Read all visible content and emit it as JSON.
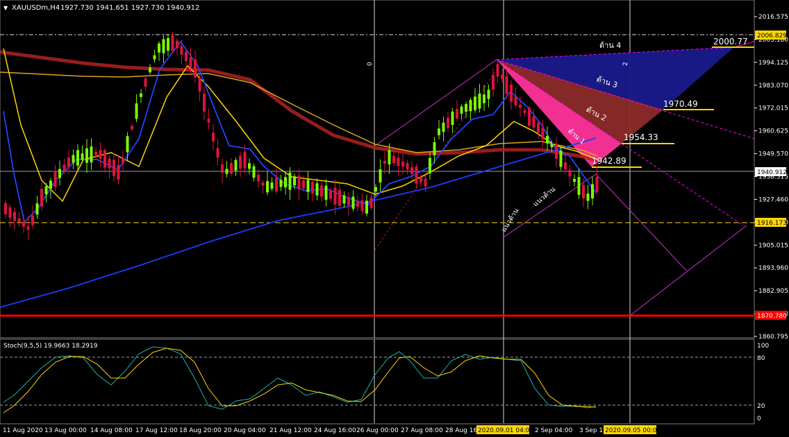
{
  "window": {
    "title": "XAUUSDm,H4",
    "ohlc": "1927.730 1941.651 1927.730 1940.912"
  },
  "price_axis": {
    "ticks": [
      "2016.575",
      "2005.180",
      "1994.125",
      "1983.070",
      "1972.015",
      "1960.625",
      "1949.570",
      "1938.515",
      "1927.460",
      "1916.070",
      "1905.015",
      "1893.960",
      "1882.905",
      "1871.850",
      "1860.795"
    ],
    "tags": {
      "upper_level": "2006.829",
      "current": "1940.912",
      "support": "1916.173",
      "lower_level": "1870.780"
    }
  },
  "time_axis": {
    "labels": [
      "11 Aug 2020",
      "13 Aug 00:00",
      "14 Aug 08:00",
      "17 Aug 12:00",
      "18 Aug 20:00",
      "20 Aug 04:00",
      "21 Aug 12:00",
      "24 Aug 16:00",
      "26 Aug 00:00",
      "27 Aug 08:00",
      "28 Aug 16",
      "2 Sep 04:00",
      "3 Sep 1"
    ],
    "tags": [
      "2020.09.01 04:00",
      "2020.09.05 00:00"
    ]
  },
  "annotations": {
    "levels": [
      "2000.77",
      "1970.49",
      "1954.33",
      "1942.89"
    ],
    "resist": [
      "ต้าน 4",
      "ต้าน 3",
      "ต้าน 2",
      "ต้าน 1"
    ],
    "brace_left": "แนวต้าน",
    "brace_right": "แนวต้าน",
    "vline_a": "0",
    "vline_b": "2"
  },
  "stoch": {
    "label": "Stoch(9,5,5) 19.9663 18.2919",
    "levels": [
      "100",
      "80",
      "20",
      "0"
    ]
  },
  "colors": {
    "background": "#000000",
    "bull": "#7CFC00",
    "bear": "#DC143C",
    "ma_blue": "#1E3CFF",
    "ma_gold": "#FFD700",
    "ma_red": "#B22222",
    "fan_magenta": "#FF00FF",
    "fan_pink": "#FF3399",
    "fan_brown": "#A52A2A",
    "fan_navy": "#1A1A8C",
    "support_line": "#FF0000"
  }
}
